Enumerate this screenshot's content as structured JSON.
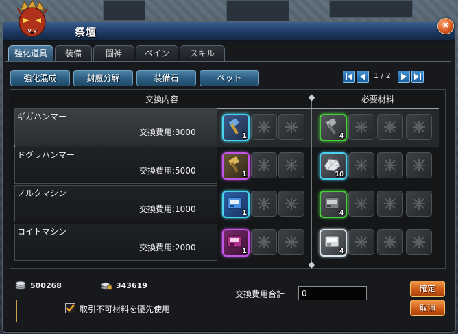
{
  "window": {
    "title": "祭壇",
    "close_glyph": "×"
  },
  "tabs": [
    {
      "label": "強化道具",
      "active": true
    },
    {
      "label": "装備",
      "active": false
    },
    {
      "label": "闘神",
      "active": false
    },
    {
      "label": "ペイン",
      "active": false
    },
    {
      "label": "スキル",
      "active": false
    }
  ],
  "sub_buttons": [
    "強化混成",
    "封魔分解",
    "装備石",
    "ペット"
  ],
  "pager": {
    "text": "1 / 2"
  },
  "headers": {
    "left": "交換内容",
    "right": "必要材料"
  },
  "rows": [
    {
      "name": "ギガハンマー",
      "cost_label": "交換費用:3000",
      "selected": true,
      "item": {
        "icon": "hammer-blue-icon",
        "count": "1",
        "glow": "cyan"
      },
      "material": {
        "icon": "hammer-gray-icon",
        "count": "4",
        "glow": "green"
      }
    },
    {
      "name": "ドグラハンマー",
      "cost_label": "交換費用:5000",
      "selected": false,
      "item": {
        "icon": "hammer-gold-icon",
        "count": "1",
        "glow": "purple"
      },
      "material": {
        "icon": "ore-white-icon",
        "count": "10",
        "glow": "cyan"
      }
    },
    {
      "name": "ノルクマシン",
      "cost_label": "交換費用:1000",
      "selected": false,
      "item": {
        "icon": "machine-blue-icon",
        "count": "1",
        "glow": "cyan"
      },
      "material": {
        "icon": "machine-gray-icon",
        "count": "4",
        "glow": "green"
      }
    },
    {
      "name": "コイトマシン",
      "cost_label": "交換費用:2000",
      "selected": false,
      "item": {
        "icon": "machine-purple-icon",
        "count": "1",
        "glow": "purple"
      },
      "material": {
        "icon": "machine-white-icon",
        "count": "4",
        "glow": "white"
      }
    }
  ],
  "currency": {
    "primary": "500268",
    "secondary": "343619"
  },
  "total": {
    "label": "交換費用合計",
    "value": "0"
  },
  "checkbox": {
    "label": "取引不可材料を優先使用",
    "checked": true
  },
  "actions": {
    "confirm": "確定",
    "cancel": "取消"
  },
  "colors": {
    "title_bar": "#1e3a63",
    "button_blue": "#2e5f83",
    "button_orange": "#cf5b17",
    "glow_cyan": "#49d3ef",
    "glow_purple": "#c254e6",
    "glow_green": "#48d13c"
  }
}
